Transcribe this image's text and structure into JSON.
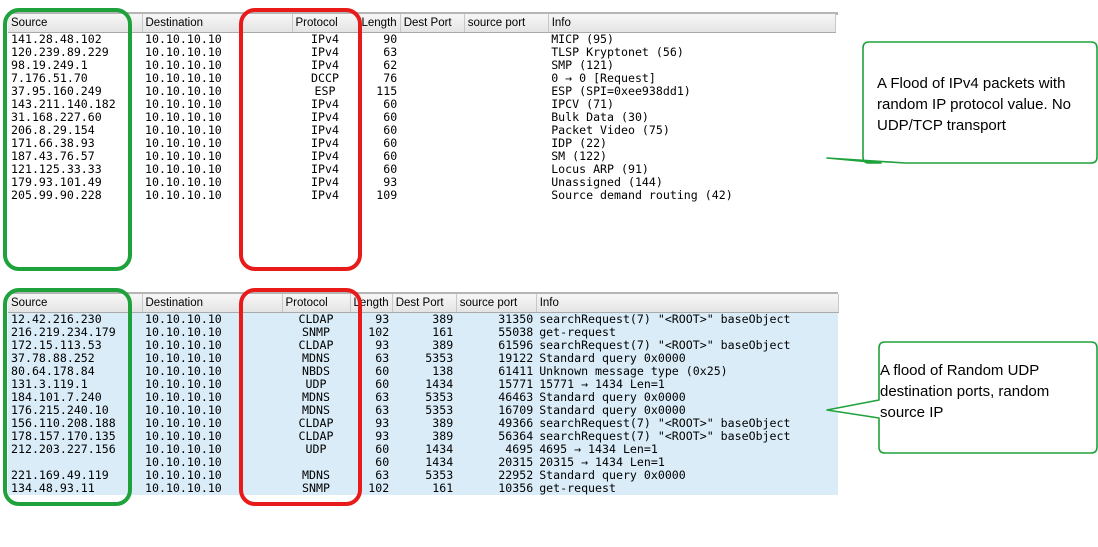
{
  "table1": {
    "headers": [
      "Source",
      "Destination",
      "Protocol",
      "Length",
      "Dest Port",
      "source port",
      "Info"
    ],
    "rows": [
      [
        "141.28.48.102",
        "10.10.10.10",
        "IPv4",
        "90",
        "",
        "",
        "MICP (95)"
      ],
      [
        "120.239.89.229",
        "10.10.10.10",
        "IPv4",
        "63",
        "",
        "",
        "TLSP Kryptonet (56)"
      ],
      [
        "98.19.249.1",
        "10.10.10.10",
        "IPv4",
        "62",
        "",
        "",
        "SMP (121)"
      ],
      [
        "7.176.51.70",
        "10.10.10.10",
        "DCCP",
        "76",
        "",
        "",
        "0 → 0 [Request]"
      ],
      [
        "37.95.160.249",
        "10.10.10.10",
        "ESP",
        "115",
        "",
        "",
        "ESP (SPI=0xee938dd1)"
      ],
      [
        "143.211.140.182",
        "10.10.10.10",
        "IPv4",
        "60",
        "",
        "",
        "IPCV (71)"
      ],
      [
        "31.168.227.60",
        "10.10.10.10",
        "IPv4",
        "60",
        "",
        "",
        "Bulk Data (30)"
      ],
      [
        "206.8.29.154",
        "10.10.10.10",
        "IPv4",
        "60",
        "",
        "",
        "Packet Video (75)"
      ],
      [
        "171.66.38.93",
        "10.10.10.10",
        "IPv4",
        "60",
        "",
        "",
        "IDP (22)"
      ],
      [
        "187.43.76.57",
        "10.10.10.10",
        "IPv4",
        "60",
        "",
        "",
        "SM (122)"
      ],
      [
        "121.125.33.33",
        "10.10.10.10",
        "IPv4",
        "60",
        "",
        "",
        "Locus ARP (91)"
      ],
      [
        "179.93.101.49",
        "10.10.10.10",
        "IPv4",
        "93",
        "",
        "",
        "Unassigned (144)"
      ],
      [
        "205.99.90.228",
        "10.10.10.10",
        "IPv4",
        "109",
        "",
        "",
        "Source demand routing (42)"
      ]
    ]
  },
  "table2": {
    "headers": [
      "Source",
      "Destination",
      "Protocol",
      "Length",
      "Dest Port",
      "source port",
      "Info"
    ],
    "rows": [
      [
        "12.42.216.230",
        "10.10.10.10",
        "CLDAP",
        "93",
        "389",
        "31350",
        "searchRequest(7) \"<ROOT>\" baseObject"
      ],
      [
        "216.219.234.179",
        "10.10.10.10",
        "SNMP",
        "102",
        "161",
        "55038",
        "get-request"
      ],
      [
        "172.15.113.53",
        "10.10.10.10",
        "CLDAP",
        "93",
        "389",
        "61596",
        "searchRequest(7) \"<ROOT>\" baseObject"
      ],
      [
        "37.78.88.252",
        "10.10.10.10",
        "MDNS",
        "63",
        "5353",
        "19122",
        "Standard query 0x0000"
      ],
      [
        "80.64.178.84",
        "10.10.10.10",
        "NBDS",
        "60",
        "138",
        "61411",
        "Unknown message type (0x25)"
      ],
      [
        "131.3.119.1",
        "10.10.10.10",
        "UDP",
        "60",
        "1434",
        "15771",
        "15771 → 1434 Len=1"
      ],
      [
        "184.101.7.240",
        "10.10.10.10",
        "MDNS",
        "63",
        "5353",
        "46463",
        "Standard query 0x0000"
      ],
      [
        "176.215.240.10",
        "10.10.10.10",
        "MDNS",
        "63",
        "5353",
        "16709",
        "Standard query 0x0000"
      ],
      [
        "156.110.208.188",
        "10.10.10.10",
        "CLDAP",
        "93",
        "389",
        "49366",
        "searchRequest(7) \"<ROOT>\" baseObject"
      ],
      [
        "178.157.170.135",
        "10.10.10.10",
        "CLDAP",
        "93",
        "389",
        "56364",
        "searchRequest(7) \"<ROOT>\" baseObject"
      ],
      [
        "212.203.227.156",
        "10.10.10.10",
        "UDP",
        "60",
        "1434",
        "4695",
        "4695 → 1434 Len=1"
      ],
      [
        "",
        "10.10.10.10",
        "",
        "60",
        "1434",
        "20315",
        "20315 → 1434 Len=1"
      ],
      [
        "221.169.49.119",
        "10.10.10.10",
        "MDNS",
        "63",
        "5353",
        "22952",
        "Standard query 0x0000"
      ],
      [
        "134.48.93.11",
        "10.10.10.10",
        "SNMP",
        "102",
        "161",
        "10356",
        "get-request"
      ]
    ]
  },
  "callout1": {
    "text": "A Flood of IPv4 packets with random IP protocol value. No UDP/TCP transport"
  },
  "callout2": {
    "text": "A flood of Random UDP destination ports, random source IP"
  },
  "colors": {
    "green_highlight": "#1fa23c",
    "red_highlight": "#e81a1a",
    "selected_row": "#d9ecf8"
  }
}
